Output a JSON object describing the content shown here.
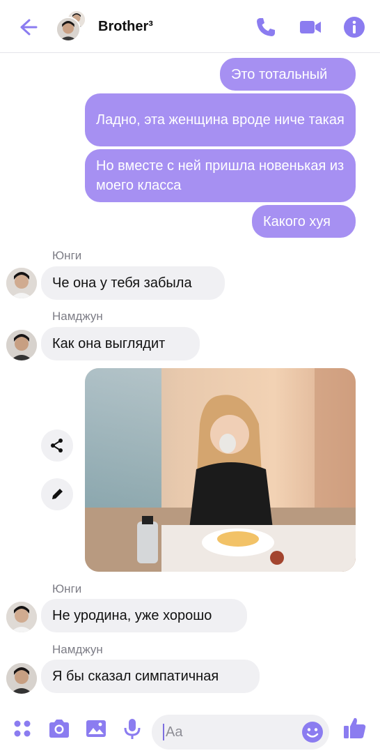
{
  "header": {
    "title": "Brother³"
  },
  "messages": {
    "out1": "Это тотальный",
    "out2": "Ладно, эта женщина вроде ниче такая",
    "out3": "Но вместе с ней пришла новенькая из моего класса",
    "out4": "Какого хуя",
    "sender1": "Юнги",
    "in1": "Че она у тебя забыла",
    "sender2": "Намджун",
    "in2": "Как она выглядит",
    "sender3": "Юнги",
    "in3": "Не уродина, уже хорошо",
    "sender4": "Намджун",
    "in4": "Я бы сказал симпатичная"
  },
  "composer": {
    "placeholder": "Aa"
  },
  "colors": {
    "accent": "#8b7cf0",
    "outgoing_bubble": "#a690f2",
    "incoming_bubble": "#f0f0f3"
  },
  "icons": [
    "back-arrow-icon",
    "phone-icon",
    "video-camera-icon",
    "info-icon",
    "share-icon",
    "pencil-icon",
    "apps-grid-icon",
    "camera-icon",
    "gallery-icon",
    "microphone-icon",
    "emoji-icon",
    "thumbs-up-icon"
  ]
}
